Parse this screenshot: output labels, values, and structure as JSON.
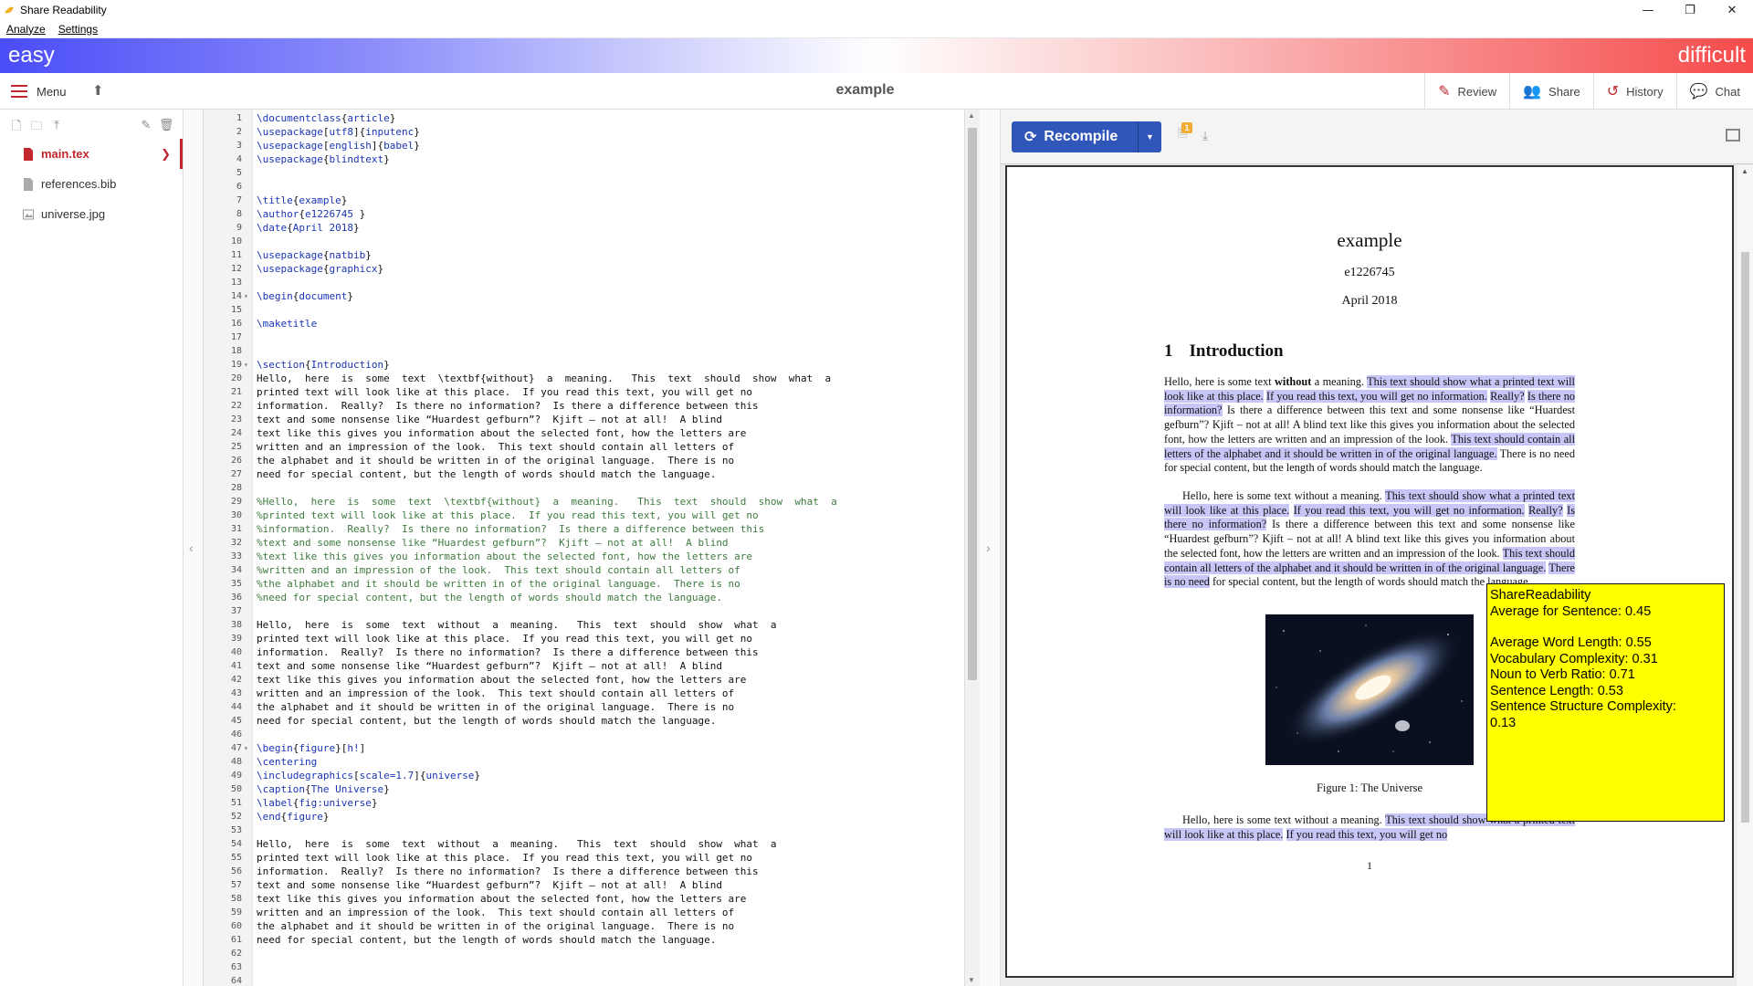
{
  "window": {
    "title": "Share Readability",
    "controls": [
      "—",
      "❐",
      "✕"
    ]
  },
  "menubar": [
    {
      "label": "Analyze"
    },
    {
      "label": "Settings"
    }
  ],
  "difficulty": {
    "easy": "easy",
    "difficult": "difficult",
    "colors": {
      "easy": "#4a4df7",
      "difficult": "#f64b4b"
    }
  },
  "toolbar": {
    "menu_label": "Menu",
    "doc_title": "example",
    "right": [
      {
        "label": "Review",
        "icon": "review-icon"
      },
      {
        "label": "Share",
        "icon": "users-icon"
      },
      {
        "label": "History",
        "icon": "history-icon"
      },
      {
        "label": "Chat",
        "icon": "chat-icon"
      }
    ]
  },
  "filetree": {
    "files": [
      {
        "name": "main.tex",
        "active": true
      },
      {
        "name": "references.bib",
        "active": false
      },
      {
        "name": "universe.jpg",
        "active": false
      }
    ]
  },
  "editor": {
    "lines": [
      "\\documentclass{article}",
      "\\usepackage[utf8]{inputenc}",
      "\\usepackage[english]{babel}",
      "\\usepackage{blindtext}",
      "",
      "",
      "\\title{example}",
      "\\author{e1226745 }",
      "\\date{April 2018}",
      "",
      "\\usepackage{natbib}",
      "\\usepackage{graphicx}",
      "",
      "\\begin{document}",
      "",
      "\\maketitle",
      "",
      "",
      "\\section{Introduction}",
      "Hello,  here  is  some  text  \\textbf{without}  a  meaning.   This  text  should  show  what  a",
      "printed text will look like at this place.  If you read this text, you will get no",
      "information.  Really?  Is there no information?  Is there a difference between this",
      "text and some nonsense like “Huardest gefburn”?  Kjift – not at all!  A blind",
      "text like this gives you information about the selected font, how the letters are",
      "written and an impression of the look.  This text should contain all letters of",
      "the alphabet and it should be written in of the original language.  There is no",
      "need for special content, but the length of words should match the language.",
      "",
      "%Hello,  here  is  some  text  \\textbf{without}  a  meaning.   This  text  should  show  what  a",
      "%printed text will look like at this place.  If you read this text, you will get no",
      "%information.  Really?  Is there no information?  Is there a difference between this",
      "%text and some nonsense like “Huardest gefburn”?  Kjift – not at all!  A blind",
      "%text like this gives you information about the selected font, how the letters are",
      "%written and an impression of the look.  This text should contain all letters of",
      "%the alphabet and it should be written in of the original language.  There is no",
      "%need for special content, but the length of words should match the language.",
      "",
      "Hello,  here  is  some  text  without  a  meaning.   This  text  should  show  what  a",
      "printed text will look like at this place.  If you read this text, you will get no",
      "information.  Really?  Is there no information?  Is there a difference between this",
      "text and some nonsense like “Huardest gefburn”?  Kjift – not at all!  A blind",
      "text like this gives you information about the selected font, how the letters are",
      "written and an impression of the look.  This text should contain all letters of",
      "the alphabet and it should be written in of the original language.  There is no",
      "need for special content, but the length of words should match the language.",
      "",
      "\\begin{figure}[h!]",
      "\\centering",
      "\\includegraphics[scale=1.7]{universe}",
      "\\caption{The Universe}",
      "\\label{fig:universe}",
      "\\end{figure}",
      "",
      "Hello,  here  is  some  text  without  a  meaning.   This  text  should  show  what  a",
      "printed text will look like at this place.  If you read this text, you will get no",
      "information.  Really?  Is there no information?  Is there a difference between this",
      "text and some nonsense like “Huardest gefburn”?  Kjift – not at all!  A blind",
      "text like this gives you information about the selected font, how the letters are",
      "written and an impression of the look.  This text should contain all letters of",
      "the alphabet and it should be written in of the original language.  There is no",
      "need for special content, but the length of words should match the language.",
      "",
      "",
      ""
    ],
    "fold_lines": [
      14,
      19,
      47
    ]
  },
  "pdf": {
    "recompile_label": "Recompile",
    "log_badge": "1",
    "title": "example",
    "author": "e1226745",
    "date": "April 2018",
    "section_number": "1",
    "section_title": "Introduction",
    "figure_caption": "Figure 1: The Universe",
    "page_number": "1",
    "highlight_color": "#c7c6f6"
  },
  "tooltip": {
    "title": "ShareReadability",
    "average": "Average for Sentence: 0.45",
    "metrics": [
      "Average Word Length: 0.55",
      "Vocabulary Complexity: 0.31",
      "Noun to Verb Ratio: 0.71",
      "Sentence Length: 0.53",
      "Sentence Structure Complexity:",
      "0.13"
    ],
    "background": "#ffff00"
  }
}
